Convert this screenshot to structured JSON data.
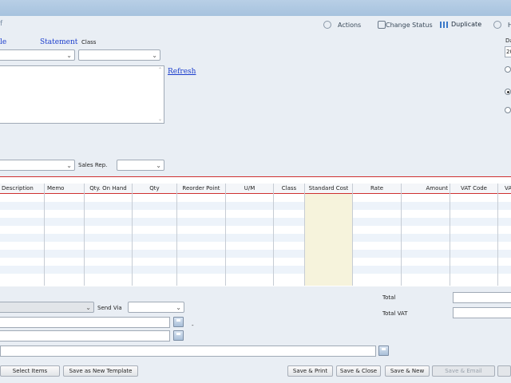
{
  "toolbar": {
    "glyph": "f",
    "actions_label": "Actions",
    "change_status_label": "Change Status",
    "duplicate_label": "Duplicate",
    "help_label": "H"
  },
  "form": {
    "link_left_label": "le",
    "statement_label": "Statement",
    "class_label": "Class",
    "date_label": "Da",
    "date_value": "20",
    "refresh_label": "Refresh",
    "sales_rep_label": "Sales Rep."
  },
  "grid": {
    "columns": [
      "Description",
      "Memo",
      "Qty. On Hand",
      "Qty",
      "Reorder Point",
      "U/M",
      "Class",
      "Standard Cost",
      "Rate",
      "Amount",
      "VAT Code",
      "VA"
    ]
  },
  "footer": {
    "send_via_label": "Send Via",
    "dash": "-",
    "total_label": "Total",
    "total_vat_label": "Total VAT"
  },
  "buttons": {
    "select_items": "Select Items",
    "save_template": "Save as New Template",
    "save_print": "Save & Print",
    "save_close": "Save & Close",
    "save_new": "Save & New",
    "save_email": "Save & Email"
  }
}
